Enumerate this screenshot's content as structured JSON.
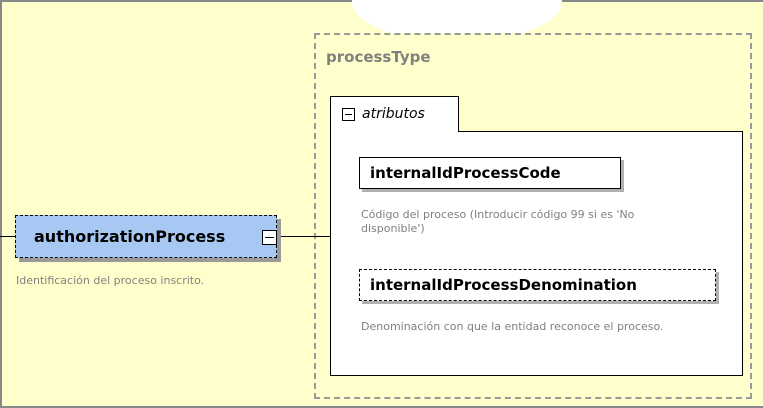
{
  "diagram": {
    "root": {
      "name": "authorizationProcess",
      "description": "Identificación del proceso inscrito.",
      "fill_color": "#A7C8F2"
    },
    "complex_type": {
      "name": "processType"
    },
    "attributes_group": {
      "label": "atributos",
      "items": [
        {
          "name": "internalIdProcessCode",
          "description": "Código del proceso  (Introducir código 99 si es 'No disponible')",
          "optional": false
        },
        {
          "name": "internalIdProcessDenomination",
          "description": "Denominación con que la entidad reconoce el proceso.",
          "optional": true
        }
      ]
    },
    "background_color": "#FFFFCC"
  }
}
